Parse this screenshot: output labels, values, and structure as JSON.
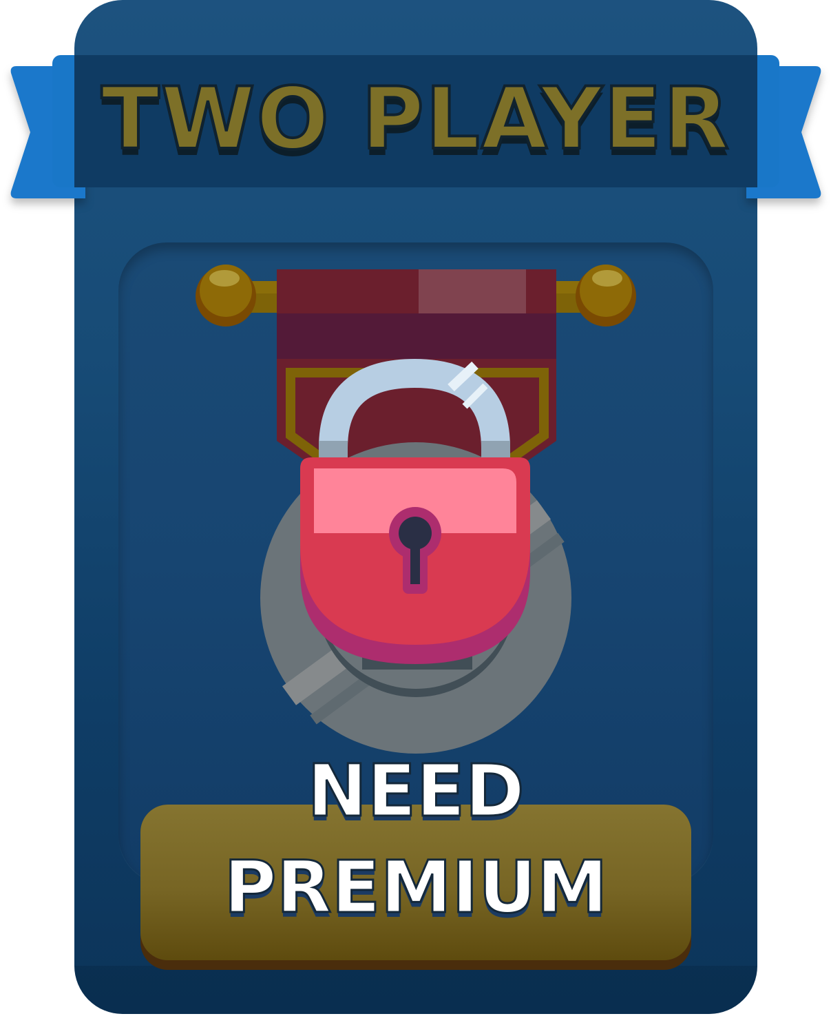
{
  "card": {
    "title": "TWO PLAYER",
    "status_label": "NEED\nPREMIUM"
  },
  "icons": {
    "lock": "padlock-icon",
    "banner": "medal-banner-icon",
    "medal": "medal-disc-icon"
  },
  "colors": {
    "card_blue": "#174b76",
    "ribbon_blue": "#1977c8",
    "title_gold": "#7d7028",
    "button_gold": "#7a6827",
    "lock_red": "#d93a51",
    "lock_pink": "#ff8499",
    "banner_maroon": "#6b1f2d",
    "medal_gray": "#6b7479"
  }
}
